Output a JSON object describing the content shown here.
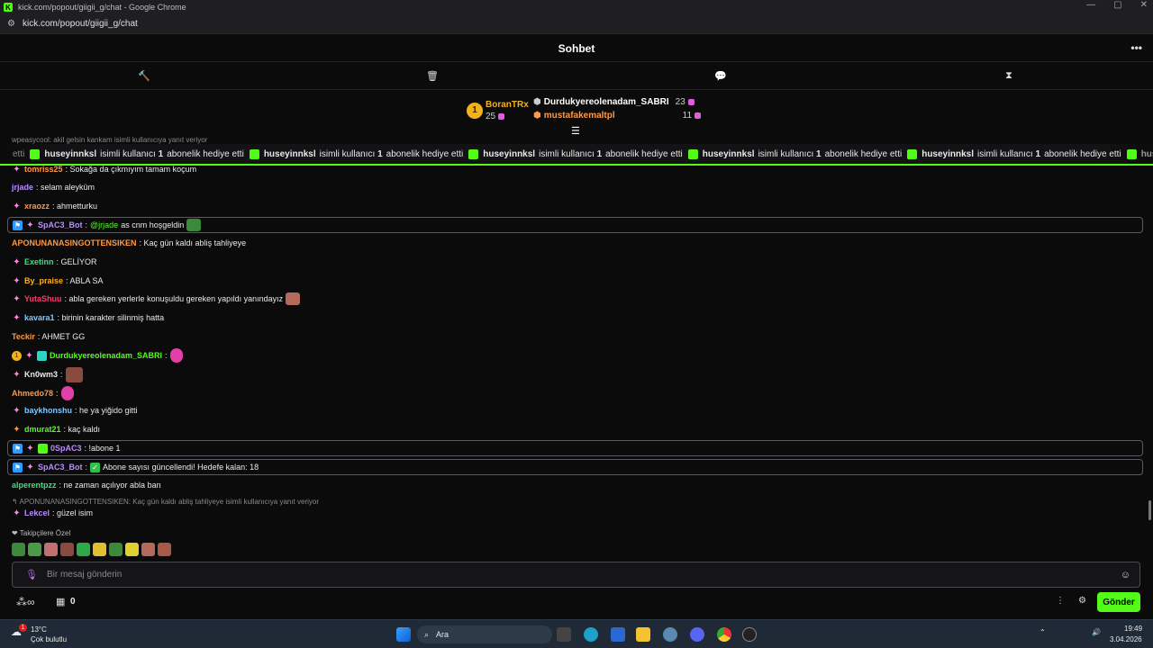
{
  "window": {
    "title": "kick.com/popout/giigii_g/chat - Google Chrome",
    "url": "kick.com/popout/giigii_g/chat"
  },
  "header": {
    "title": "Sohbet"
  },
  "leaderboard": [
    {
      "rank": "1",
      "name": "BoranTRx",
      "count": "25"
    },
    {
      "name": "Durdukyereolenadam_SABRI",
      "count": "23"
    },
    {
      "name": "mustafakemaltpl",
      "count": "11"
    }
  ],
  "pinned_reply": "wpeasycool: akil gelsin kankam isimli kullanıcıya yanıt veriyor",
  "gift_ticker": {
    "user": "huseyinnksl",
    "text1": "isimli kullanıcı",
    "num": "1",
    "text2": "abonelik hediye etti",
    "partial": "huseyinnks"
  },
  "messages": [
    {
      "user": "tomriss25",
      "text": ": Sokağa da çıkmıyım tamam koçum",
      "color": "#ff9944"
    },
    {
      "user": "jrjade",
      "text": ": selam aleyküm",
      "color": "#b98cff"
    },
    {
      "user": "xraozz",
      "text": ": ahmetturku",
      "color": "#ff9944"
    },
    {
      "user": "SpAC3_Bot",
      "text_mention": "@jrjade",
      "text": " as cnm hoşgeldin",
      "color": "#b98cff"
    },
    {
      "user": "APONUNANASINGOTTENSIKEN",
      "text": ": Kaç gün kaldı abliş tahliyeye",
      "color": "#ff9944"
    },
    {
      "user": "Exetinn",
      "text": ": GELİYOR",
      "color": "#3ee07a"
    },
    {
      "user": "By_praise",
      "text": ": ABLA SA",
      "color": "#ffb020"
    },
    {
      "user": "YutaShuu",
      "text": ": abla gereken yerlerle konuşuldu gereken yapıldı yanındayız",
      "color": "#ff3b6b"
    },
    {
      "user": "kavara1",
      "text": ": birinin karakter silinmiş hatta",
      "color": "#7ec8ff"
    },
    {
      "user": "Teckir",
      "text": ": AHMET GG",
      "color": "#ff9944"
    },
    {
      "user": "Durdukyereolenadam_SABRI",
      "text": ":",
      "color": "#53fc18"
    },
    {
      "user": "Kn0wm3",
      "text": ":",
      "color": "#eaeaea"
    },
    {
      "user": "Ahmedo78",
      "text": ":",
      "color": "#ff9944"
    },
    {
      "user": "baykhonshu",
      "text": ": he ya yiğido gitti",
      "color": "#7ec8ff"
    },
    {
      "user": "dmurat21",
      "text": ": kaç kaldı",
      "color": "#53fc18"
    },
    {
      "user": "0SpAC3",
      "text": ": !abone 1",
      "color": "#b98cff"
    },
    {
      "user": "SpAC3_Bot",
      "text": " Abone sayısı güncellendi! Hedefe kalan: 18",
      "color": "#b98cff"
    },
    {
      "user": "alperentpzz",
      "text": ": ne zaman açılıyor abla ban",
      "color": "#3ee07a"
    },
    {
      "reply": "APONUNANASINGOTTENSIKEN: Kaç gün kaldı abliş tahliyeye isimli kullanıcıya yanıt veriyor"
    },
    {
      "user": "Lekcel",
      "text": ": güzel isim",
      "color": "#b98cff"
    }
  ],
  "followers_label": "Takipçilere Özel",
  "input": {
    "placeholder": "Bir mesaj gönderin"
  },
  "bottom": {
    "points": "0",
    "send": "Gönder"
  },
  "taskbar": {
    "temp": "13°C",
    "weather": "Çok bulutlu",
    "search": "Ara",
    "time": "19:49",
    "date": "3.04.2026",
    "badge": "1"
  },
  "colors": {
    "accent": "#53fc18",
    "bg": "#0b0b0c"
  }
}
